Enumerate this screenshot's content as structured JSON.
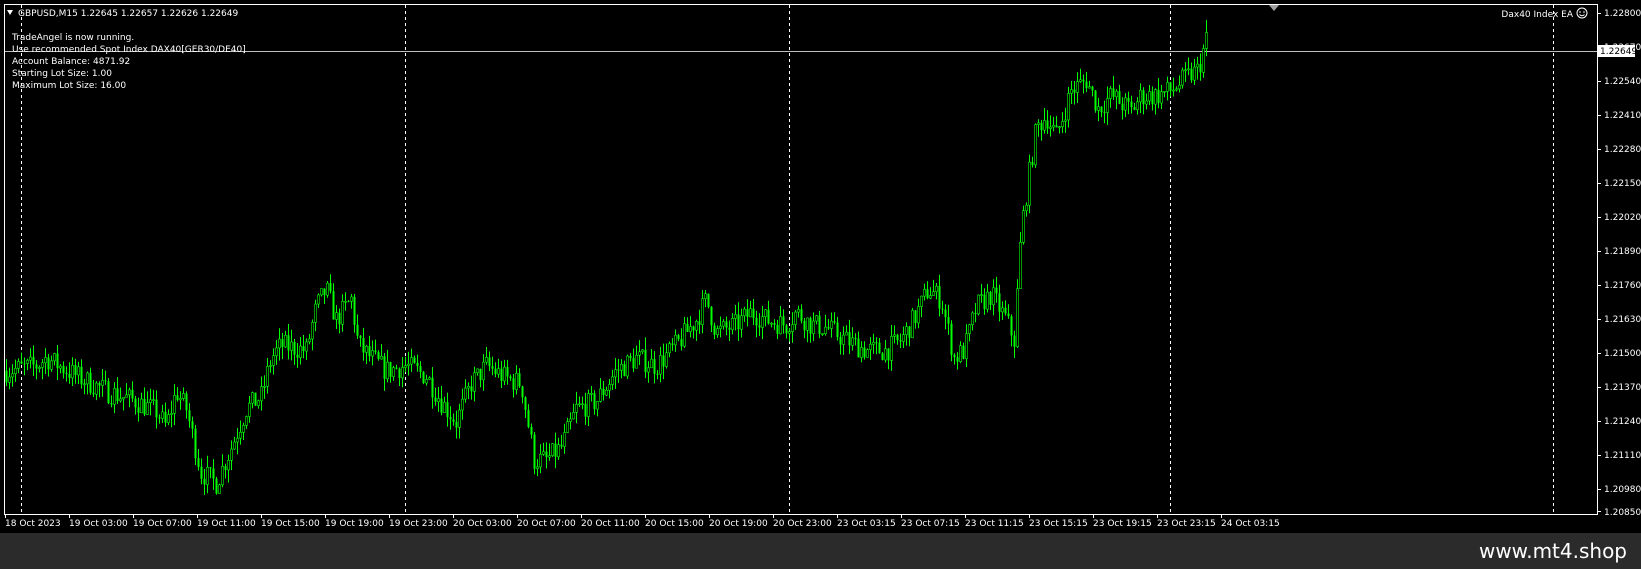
{
  "chart_header": {
    "symbol_line": "GBPUSD,M15  1.22645 1.22657 1.22626 1.22649",
    "ea_name": "Dax40 Index EA",
    "ea_icon": "smiley-face-icon"
  },
  "ea_info": [
    "TradeAngel is now running.",
    "Use recommended Spot Index DAX40[GER30/DE40]",
    "Account Balance: 4871.92",
    "Starting Lot Size: 1.00",
    "Maximum Lot Size: 16.00"
  ],
  "price_axis": {
    "labels": [
      "1.22800",
      "1.22670",
      "1.22540",
      "1.22410",
      "1.22280",
      "1.22150",
      "1.22020",
      "1.21890",
      "1.21760",
      "1.21630",
      "1.21500",
      "1.21370",
      "1.21240",
      "1.21110",
      "1.20980",
      "1.20850"
    ],
    "current_price": "1.22649"
  },
  "time_axis": {
    "labels": [
      "18 Oct 2023",
      "19 Oct 03:00",
      "19 Oct 07:00",
      "19 Oct 11:00",
      "19 Oct 15:00",
      "19 Oct 19:00",
      "19 Oct 23:00",
      "20 Oct 03:00",
      "20 Oct 07:00",
      "20 Oct 11:00",
      "20 Oct 15:00",
      "20 Oct 19:00",
      "20 Oct 23:00",
      "23 Oct 03:15",
      "23 Oct 07:15",
      "23 Oct 11:15",
      "23 Oct 15:15",
      "23 Oct 19:15",
      "23 Oct 23:15",
      "24 Oct 03:15"
    ]
  },
  "colors": {
    "background": "#000000",
    "candle": "#00ff00",
    "grid": "#ffffff",
    "text": "#ffffff",
    "footer_bg": "#2b2b2b"
  },
  "chart_data": {
    "type": "candlestick",
    "ylim": [
      1.2085,
      1.228
    ],
    "price_path": [
      [
        0,
        1.214
      ],
      [
        30,
        1.2142
      ],
      [
        40,
        1.2145
      ],
      [
        70,
        1.2138
      ],
      [
        100,
        1.2132
      ],
      [
        130,
        1.2128
      ],
      [
        150,
        1.2124
      ],
      [
        160,
        1.2118
      ],
      [
        170,
        1.2132
      ],
      [
        180,
        1.2125
      ],
      [
        195,
        1.21
      ],
      [
        210,
        1.2096
      ],
      [
        225,
        1.211
      ],
      [
        240,
        1.2125
      ],
      [
        255,
        1.213
      ],
      [
        265,
        1.2145
      ],
      [
        275,
        1.215
      ],
      [
        300,
        1.2148
      ],
      [
        310,
        1.2165
      ],
      [
        320,
        1.2172
      ],
      [
        330,
        1.216
      ],
      [
        345,
        1.2168
      ],
      [
        352,
        1.215
      ],
      [
        365,
        1.2145
      ],
      [
        380,
        1.214
      ],
      [
        400,
        1.2142
      ],
      [
        420,
        1.2138
      ],
      [
        435,
        1.2128
      ],
      [
        450,
        1.212
      ],
      [
        465,
        1.2135
      ],
      [
        480,
        1.2142
      ],
      [
        500,
        1.2137
      ],
      [
        515,
        1.2135
      ],
      [
        528,
        1.2105
      ],
      [
        540,
        1.2105
      ],
      [
        555,
        1.211
      ],
      [
        570,
        1.2125
      ],
      [
        590,
        1.2128
      ],
      [
        610,
        1.214
      ],
      [
        630,
        1.2145
      ],
      [
        650,
        1.2142
      ],
      [
        670,
        1.215
      ],
      [
        690,
        1.216
      ],
      [
        700,
        1.2168
      ],
      [
        710,
        1.2155
      ],
      [
        730,
        1.2158
      ],
      [
        745,
        1.2163
      ],
      [
        760,
        1.216
      ],
      [
        780,
        1.2158
      ],
      [
        790,
        1.2163
      ],
      [
        805,
        1.2158
      ],
      [
        820,
        1.2157
      ],
      [
        840,
        1.2152
      ],
      [
        860,
        1.2148
      ],
      [
        880,
        1.2148
      ],
      [
        895,
        1.2152
      ],
      [
        910,
        1.2162
      ],
      [
        922,
        1.2172
      ],
      [
        935,
        1.2168
      ],
      [
        948,
        1.2145
      ],
      [
        958,
        1.2148
      ],
      [
        970,
        1.2165
      ],
      [
        985,
        1.217
      ],
      [
        1000,
        1.216
      ],
      [
        1008,
        1.2152
      ],
      [
        1015,
        1.2195
      ],
      [
        1022,
        1.2215
      ],
      [
        1030,
        1.2235
      ],
      [
        1040,
        1.224
      ],
      [
        1050,
        1.2232
      ],
      [
        1065,
        1.225
      ],
      [
        1080,
        1.2254
      ],
      [
        1092,
        1.2243
      ],
      [
        1105,
        1.2248
      ],
      [
        1115,
        1.2245
      ],
      [
        1125,
        1.2242
      ],
      [
        1135,
        1.2248
      ],
      [
        1150,
        1.2248
      ],
      [
        1165,
        1.225
      ],
      [
        1180,
        1.2255
      ],
      [
        1192,
        1.2258
      ],
      [
        1200,
        1.227
      ],
      [
        1208,
        1.2265
      ]
    ]
  }
}
